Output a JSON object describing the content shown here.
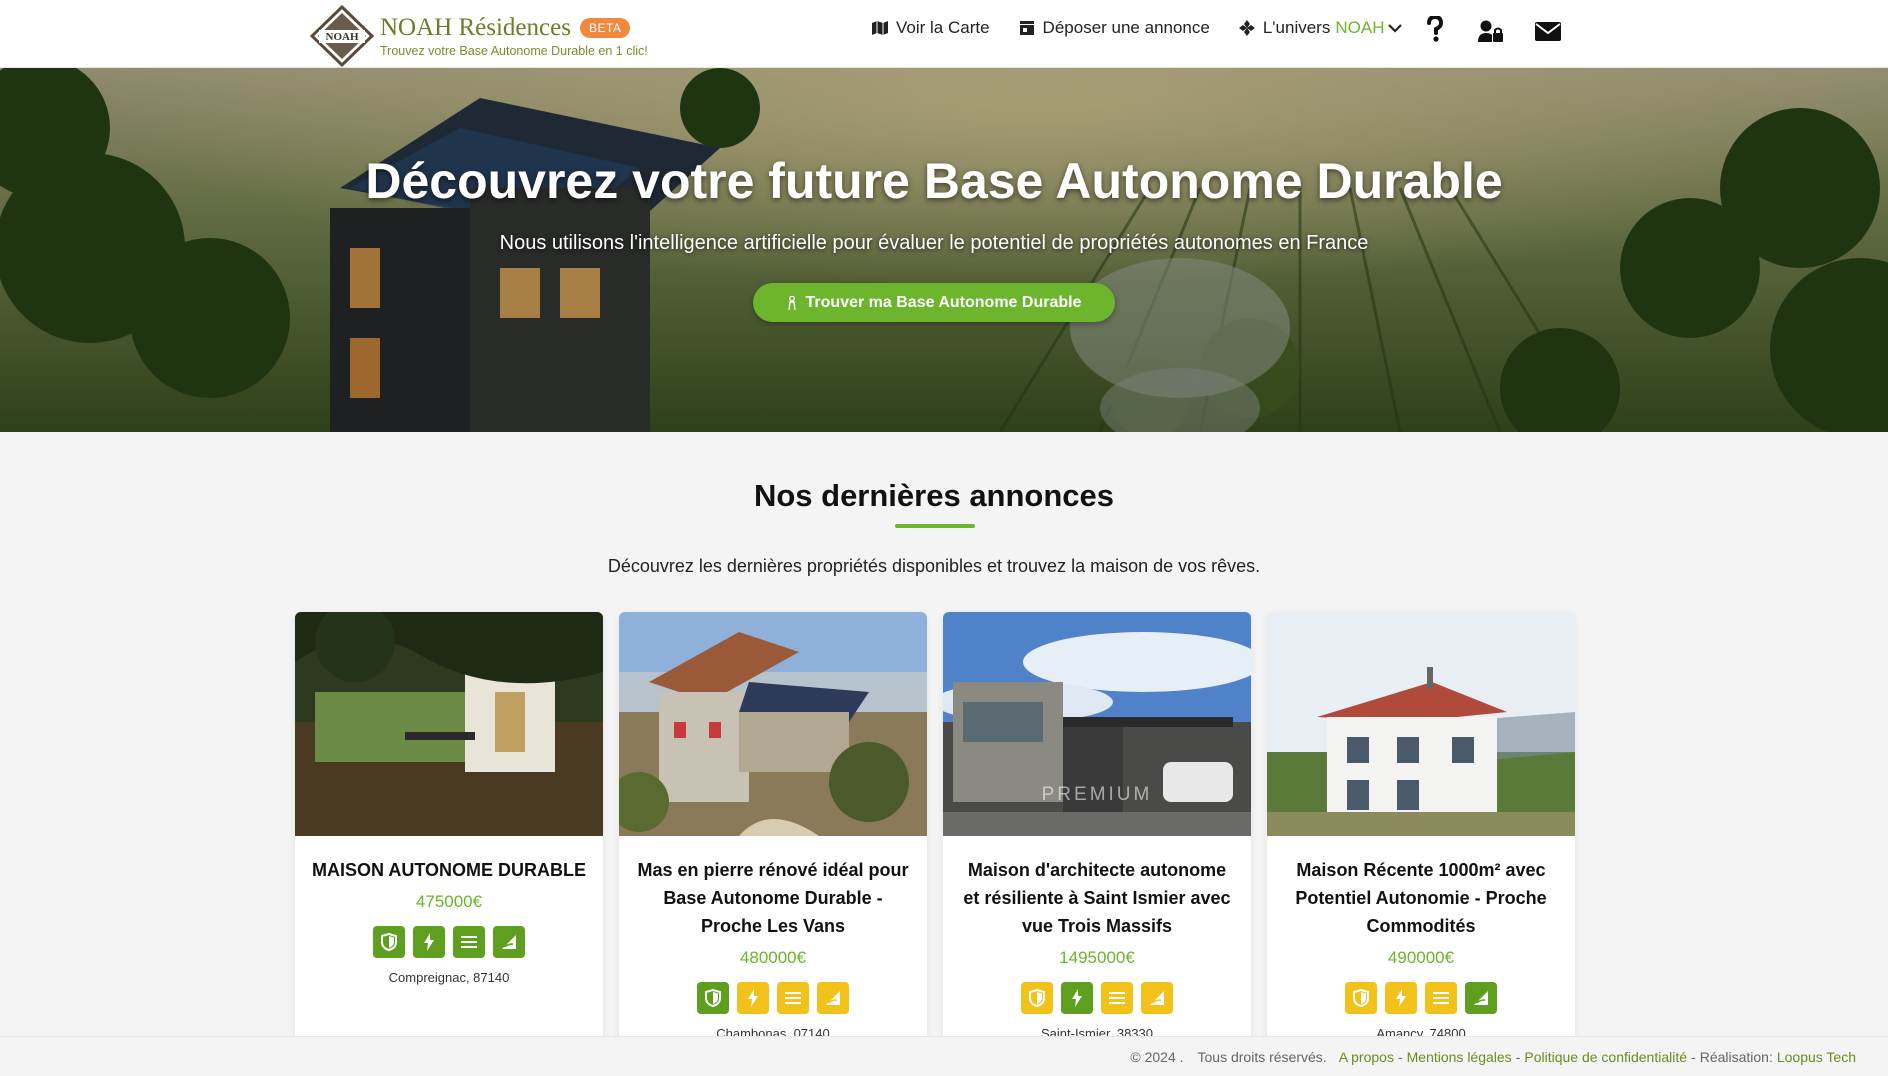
{
  "brand": {
    "name": "NOAH Résidences",
    "badge": "BETA",
    "tagline": "Trouvez votre Base Autonome Durable en 1 clic!",
    "logo_text": "NOAH"
  },
  "nav": {
    "map": "Voir la Carte",
    "post": "Déposer une annonce",
    "universe": "L'univers",
    "universe_accent": "NOAH"
  },
  "hero": {
    "title": "Découvrez votre future Base Autonome Durable",
    "subtitle": "Nous utilisons l'intelligence artificielle pour évaluer le potentiel de propriétés autonomes en France",
    "cta": "Trouver ma Base Autonome Durable"
  },
  "section": {
    "title": "Nos dernières annonces",
    "subtitle": "Découvrez les dernières propriétés disponibles et trouvez la maison de vos rêves."
  },
  "listings": [
    {
      "title": "MAISON AUTONOME DURABLE",
      "price": "475000€",
      "location": "Compreignac, 87140",
      "badges": [
        "green",
        "green",
        "green",
        "green"
      ]
    },
    {
      "title": "Mas en pierre rénové idéal pour Base Autonome Durable - Proche Les Vans",
      "price": "480000€",
      "location": "Chambonas, 07140",
      "badges": [
        "green",
        "yellow",
        "yellow",
        "yellow"
      ]
    },
    {
      "title": "Maison d'architecte autonome et résiliente à Saint Ismier avec vue Trois Massifs",
      "price": "1495000€",
      "location": "Saint-Ismier, 38330",
      "watermark": "PREMIUM",
      "badges": [
        "yellow",
        "green",
        "yellow",
        "yellow"
      ]
    },
    {
      "title": "Maison Récente 1000m² avec Potentiel Autonomie - Proche Commodités",
      "price": "490000€",
      "location": "Amancy, 74800",
      "badges": [
        "yellow",
        "yellow",
        "yellow",
        "green"
      ]
    }
  ],
  "footer": {
    "copyright": "© 2024 .",
    "rights": "Tous droits réservés.",
    "about": "A propos",
    "legal": "Mentions légales",
    "privacy": "Politique de confidentialité",
    "credit_prefix": "Réalisation:",
    "credit": "Loopus Tech"
  },
  "colors": {
    "accent": "#6cb52d",
    "brand_olive": "#6d7d28",
    "badge_green": "#5f9f1f",
    "badge_yellow": "#f2c21a",
    "beta": "#f0883e"
  },
  "icons": [
    "map-icon",
    "store-icon",
    "diamond-icon",
    "chevron-down-icon",
    "question-icon",
    "user-lock-icon",
    "envelope-icon",
    "person-icon",
    "shield-icon",
    "bolt-icon",
    "menu-lines-icon",
    "signal-icon"
  ]
}
